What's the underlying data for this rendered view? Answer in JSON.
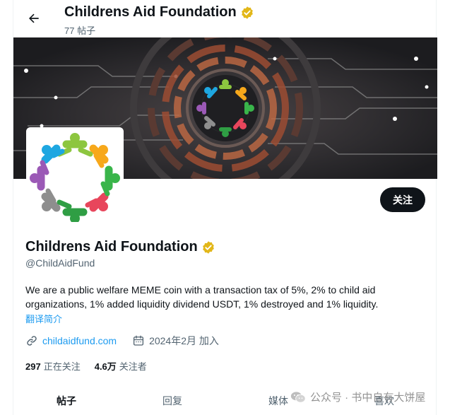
{
  "header": {
    "title": "Childrens Aid Foundation",
    "post_count": "77 帖子"
  },
  "profile": {
    "name": "Childrens Aid Foundation",
    "handle": "@ChildAidFund",
    "bio": "We are a public welfare MEME coin with a transaction tax of 5%, 2%  to child aid organizations, 1% added liquidity dividend USDT, 1% destroyed and 1% liquidity.",
    "translate_label": "翻译简介",
    "website": "childaidfund.com",
    "joined": "2024年2月 加入",
    "follow_label": "关注"
  },
  "stats": {
    "following_count": "297",
    "following_label": "正在关注",
    "followers_count": "4.6万",
    "followers_label": "关注者"
  },
  "tabs": [
    {
      "label": "帖子"
    },
    {
      "label": "回复"
    },
    {
      "label": "媒体"
    },
    {
      "label": "喜欢"
    }
  ],
  "watermark": {
    "text": "公众号 · 书中自有大饼屋"
  },
  "colors": {
    "verified_badge": "#e2b719",
    "link": "#1d9bf0",
    "follow_button": "#0f1419",
    "banner_bg": "#2a2a2c",
    "banner_accent": "#b05a3c"
  },
  "icons": {
    "back": "arrow-left-icon",
    "verified": "verified-badge-icon",
    "link": "link-icon",
    "calendar": "calendar-icon",
    "wechat": "wechat-icon"
  }
}
